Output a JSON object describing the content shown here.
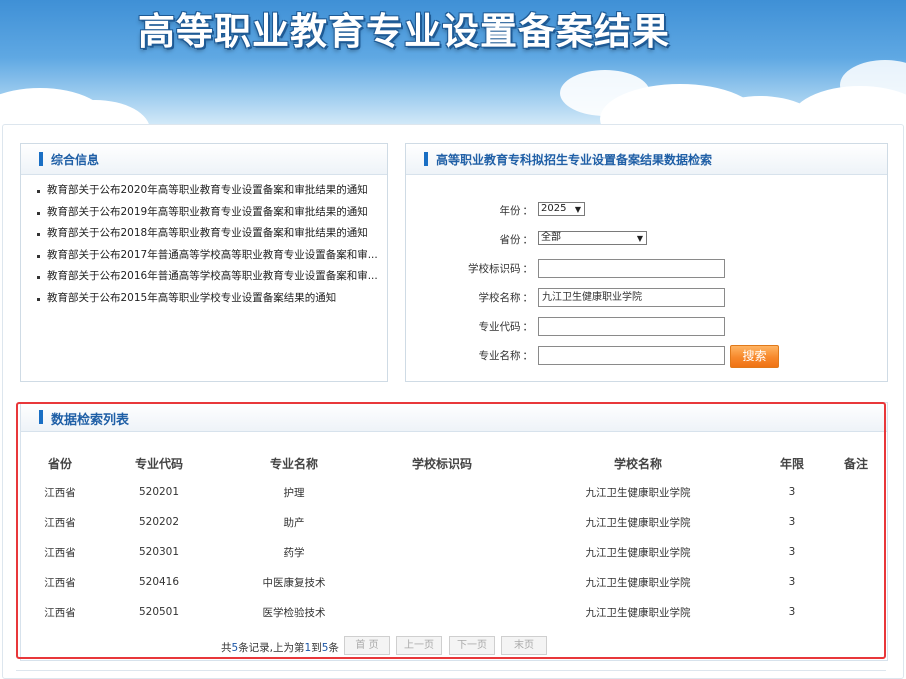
{
  "banner": {
    "title": "高等职业教育专业设置备案结果"
  },
  "news_panel": {
    "title": "综合信息",
    "items": [
      "教育部关于公布2020年高等职业教育专业设置备案和审批结果的通知",
      "教育部关于公布2019年高等职业教育专业设置备案和审批结果的通知",
      "教育部关于公布2018年高等职业教育专业设置备案和审批结果的通知",
      "教育部关于公布2017年普通高等学校高等职业教育专业设置备案和审...",
      "教育部关于公布2016年普通高等学校高等职业教育专业设置备案和审...",
      "教育部关于公布2015年高等职业学校专业设置备案结果的通知"
    ]
  },
  "search_panel": {
    "title": "高等职业教育专科拟招生专业设置备案结果数据检索",
    "year_label": "年份",
    "year_value": "2025",
    "province_label": "省份",
    "province_value": "全部",
    "school_id_label": "学校标识码",
    "school_id_value": "",
    "school_name_label": "学校名称",
    "school_name_value": "九江卫生健康职业学院",
    "major_code_label": "专业代码",
    "major_code_value": "",
    "major_name_label": "专业名称",
    "major_name_value": "",
    "search_button": "搜索",
    "colon": "："
  },
  "results": {
    "title": "数据检索列表",
    "columns": [
      "省份",
      "专业代码",
      "专业名称",
      "学校标识码",
      "学校名称",
      "年限",
      "备注"
    ],
    "rows": [
      [
        "江西省",
        "520201",
        "护理",
        "",
        "九江卫生健康职业学院",
        "3",
        ""
      ],
      [
        "江西省",
        "520202",
        "助产",
        "",
        "九江卫生健康职业学院",
        "3",
        ""
      ],
      [
        "江西省",
        "520301",
        "药学",
        "",
        "九江卫生健康职业学院",
        "3",
        ""
      ],
      [
        "江西省",
        "520416",
        "中医康复技术",
        "",
        "九江卫生健康职业学院",
        "3",
        ""
      ],
      [
        "江西省",
        "520501",
        "医学检验技术",
        "",
        "九江卫生健康职业学院",
        "3",
        ""
      ]
    ]
  },
  "pager": {
    "info_prefix": "共",
    "total": "5",
    "info_mid": "条记录,上为第",
    "from": "1",
    "info_to": "到",
    "to": "5",
    "info_suffix": "条",
    "first": "首 页",
    "prev": "上一页",
    "next": "下一页",
    "last": "末页"
  },
  "colors": {
    "accent_blue": "#1a6fc4",
    "highlight_red": "#e8373a",
    "search_orange": "#f7882b"
  }
}
